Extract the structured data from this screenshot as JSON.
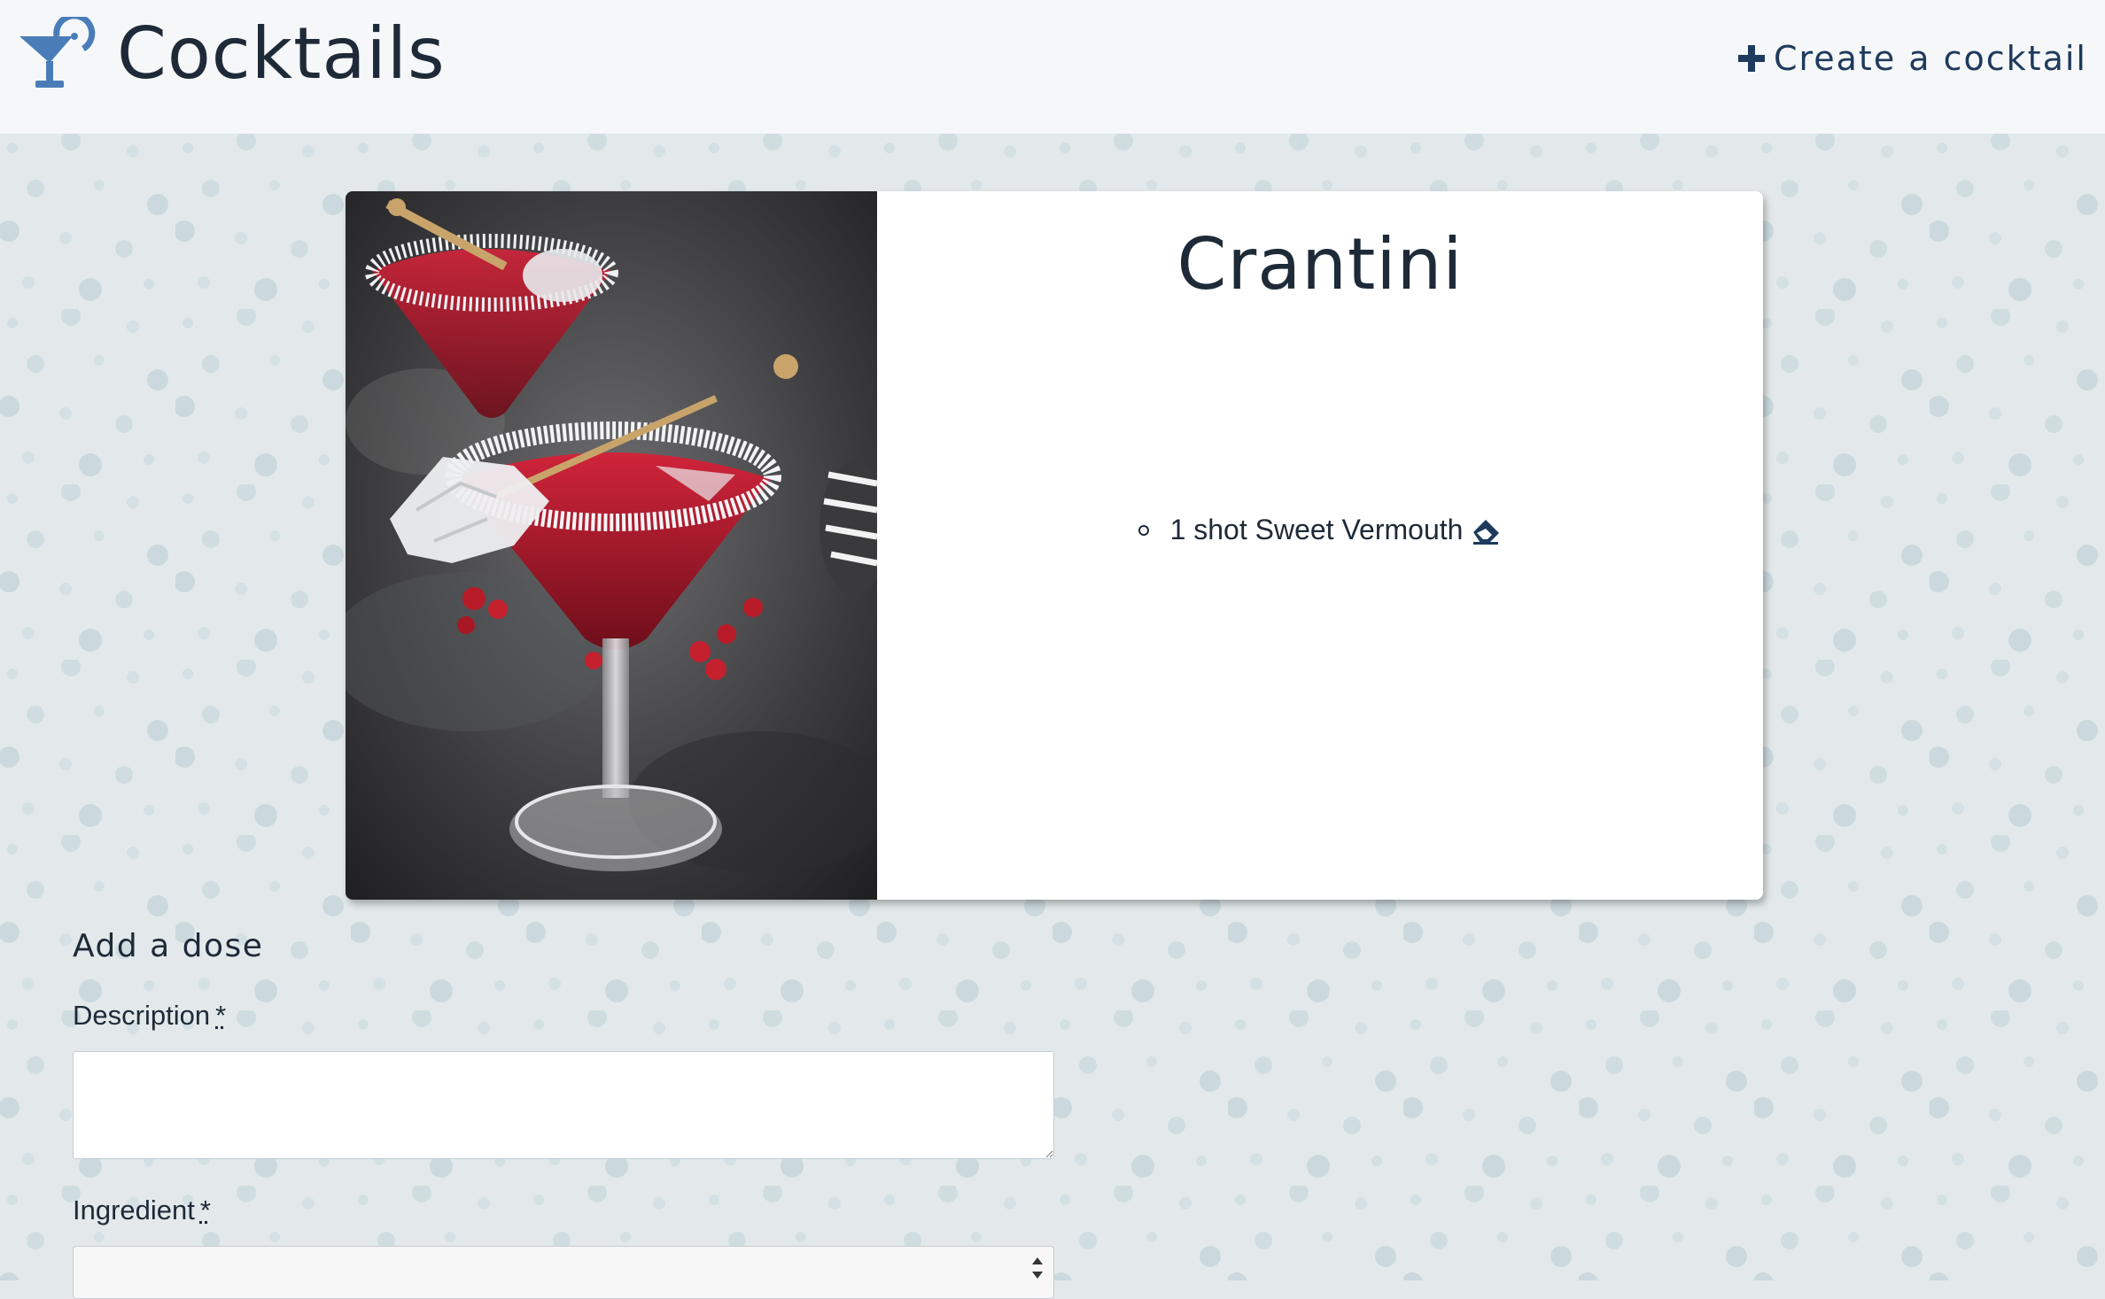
{
  "navbar": {
    "brand_title": "Cocktails",
    "brand_icon": "cocktail-glass-icon",
    "create_label": "Create a cocktail",
    "create_icon": "plus-icon"
  },
  "cocktail": {
    "name": "Crantini",
    "image_icon": "cocktail-photo",
    "doses": [
      {
        "text": "1 shot Sweet Vermouth",
        "delete_icon": "eraser-icon"
      }
    ]
  },
  "dose_form": {
    "heading": "Add a dose",
    "description_label": "Description",
    "description_value": "",
    "ingredient_label": "Ingredient",
    "ingredient_value": "",
    "required_marker": "*"
  },
  "colors": {
    "accent_blue": "#4a7db8",
    "text_dark": "#1e2a38",
    "background": "#e3e9ea",
    "navbar_bg": "#f5f7f8",
    "dot_color": "#cfdde1"
  }
}
